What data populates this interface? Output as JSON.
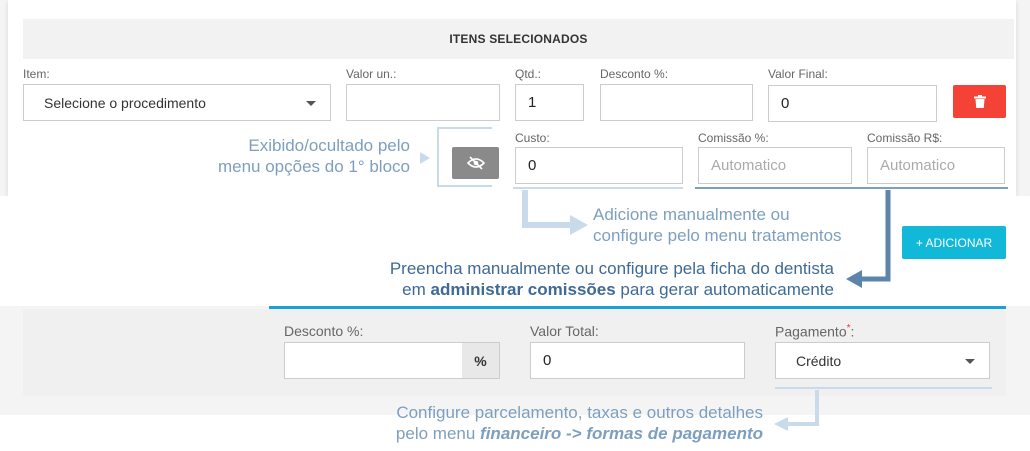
{
  "section": {
    "title": "ITENS SELECIONADOS"
  },
  "fields": {
    "item": {
      "label": "Item:",
      "value": "Selecione o procedimento"
    },
    "valor_un": {
      "label": "Valor un.:",
      "value": ""
    },
    "qtd": {
      "label": "Qtd.:",
      "value": "1"
    },
    "desconto": {
      "label": "Desconto %:",
      "value": ""
    },
    "valor_final": {
      "label": "Valor Final:",
      "value": "0"
    },
    "custo": {
      "label": "Custo:",
      "value": "0"
    },
    "comissao_pct": {
      "label": "Comissão %:",
      "placeholder": "Automatico"
    },
    "comissao_rs": {
      "label": "Comissão R$:",
      "placeholder": "Automatico"
    }
  },
  "buttons": {
    "add_label": "+ ADICIONAR"
  },
  "totals": {
    "desconto": {
      "label": "Desconto %:",
      "value": "",
      "suffix": "%"
    },
    "valor_total": {
      "label": "Valor Total:",
      "value": "0"
    },
    "pagamento": {
      "label": "Pagamento",
      "required_mark": "*",
      "colon": ":",
      "value": "Crédito"
    }
  },
  "annotations": {
    "eye_note_line1": "Exibido/ocultado pelo",
    "eye_note_line2": "menu opções do 1° bloco",
    "custo_note_line1": "Adicione manualmente ou",
    "custo_note_line2": "configure pelo menu tratamentos",
    "comissao_note_line1": "Preencha manualmente ou configure pela ficha do dentista",
    "comissao_note_line2_pre": "em ",
    "comissao_note_line2_bold": "administrar comissões",
    "comissao_note_line2_post": " para gerar automaticamente",
    "pagamento_note_line1": "Configure parcelamento, taxas e outros detalhes",
    "pagamento_note_line2_pre": "pelo menu ",
    "pagamento_note_line2_b1": "financeiro",
    "pagamento_note_line2_mid": " -> ",
    "pagamento_note_line2_b2": "formas de pagamento"
  },
  "colors": {
    "accent": "#11b8d8",
    "danger": "#f44336",
    "annotation": "#7d9fbf",
    "annotation_dark": "#3f6a95",
    "rule": "#1a9fd9"
  },
  "icons": {
    "delete": "trash-icon",
    "visibility": "eye-off-icon",
    "dropdown": "chevron-down-icon"
  }
}
